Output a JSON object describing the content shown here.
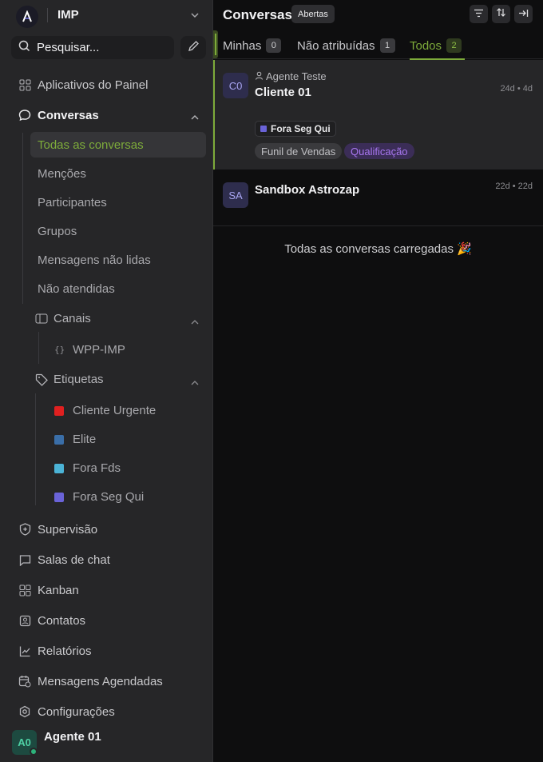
{
  "workspace": {
    "name": "IMP"
  },
  "search": {
    "placeholder": "Pesquisar..."
  },
  "nav": {
    "dashboard_apps": "Aplicativos do Painel",
    "conversations": "Conversas",
    "conversation_sub": {
      "active": "Todas as conversas",
      "items": [
        "Menções",
        "Participantes",
        "Grupos",
        "Mensagens não lidas",
        "Não atendidas"
      ]
    },
    "channels": {
      "label": "Canais",
      "items": [
        "WPP-IMP"
      ]
    },
    "labels": {
      "label": "Etiquetas",
      "items": [
        {
          "name": "Cliente Urgente",
          "color": "#e02020"
        },
        {
          "name": "Elite",
          "color": "#3a6ea8"
        },
        {
          "name": "Fora Fds",
          "color": "#4bb3d6"
        },
        {
          "name": "Fora Seg Qui",
          "color": "#6a63d8"
        }
      ]
    },
    "bottom": [
      "Supervisão",
      "Salas de chat",
      "Kanban",
      "Contatos",
      "Relatórios",
      "Mensagens Agendadas",
      "Configurações"
    ]
  },
  "user": {
    "initials": "A0",
    "name": "Agente 01",
    "status_color": "#2db27a"
  },
  "main": {
    "title": "Conversas",
    "status_filter": "Abertas",
    "tabs": [
      {
        "label": "Minhas",
        "count": "0"
      },
      {
        "label": "Não atribuídas",
        "count": "1"
      },
      {
        "label": "Todos",
        "count": "2"
      }
    ],
    "conversations": [
      {
        "initials": "C0",
        "agent": "Agente Teste",
        "name": "Cliente 01",
        "time": "24d • 4d",
        "label": "Fora Seg Qui",
        "funnel": "Funil de Vendas",
        "stage": "Qualificação"
      },
      {
        "initials": "SA",
        "name": "Sandbox Astrozap",
        "time": "22d • 22d"
      }
    ],
    "loaded_text": "Todas as conversas carregadas 🎉"
  },
  "colors": {
    "accent": "#7dab3a",
    "sidebar_bg": "#262628",
    "main_bg": "#0e0e0f"
  }
}
